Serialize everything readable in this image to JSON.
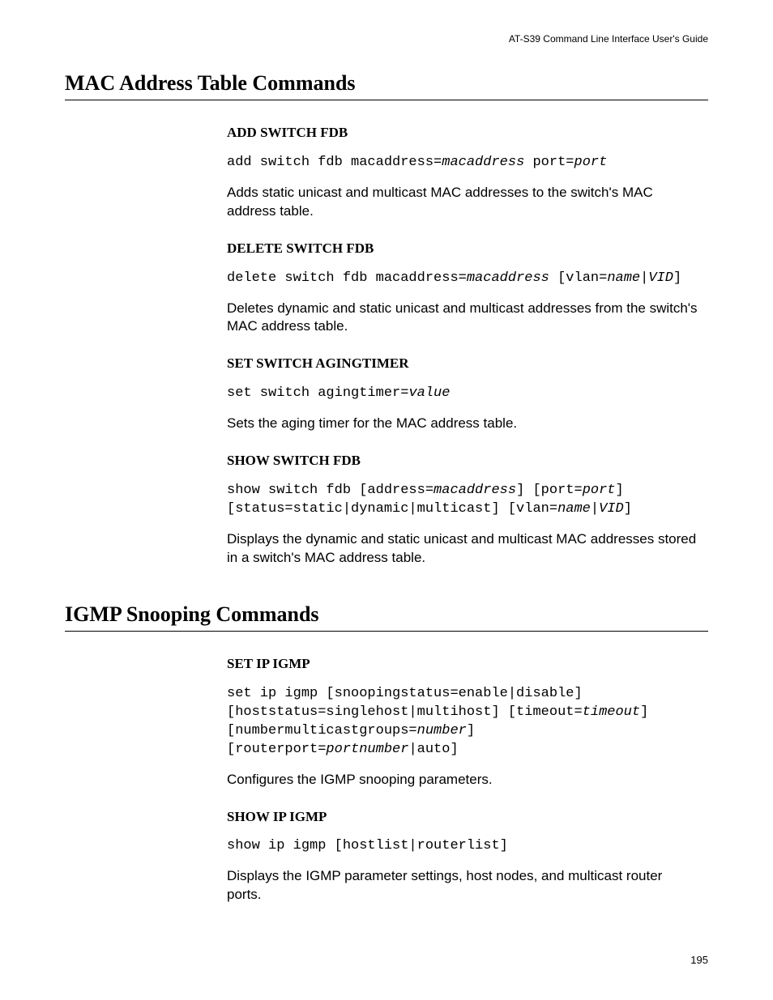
{
  "header": "AT-S39 Command Line Interface User's Guide",
  "pageNumber": "195",
  "sections": [
    {
      "title": "MAC Address Table Commands",
      "commands": [
        {
          "name": "ADD SWITCH FDB",
          "syntax": "add switch fdb macaddress=<i>macaddress</i> port=<i>port</i>",
          "desc": "Adds static unicast and multicast MAC addresses to the switch's MAC address table."
        },
        {
          "name": "DELETE SWITCH FDB",
          "syntax": "delete switch fdb macaddress=<i>macaddress</i> [vlan=<i>name</i>|<i>VID</i>]",
          "desc": "Deletes dynamic and static unicast and multicast addresses from the switch's MAC address table."
        },
        {
          "name": "SET SWITCH AGINGTIMER",
          "syntax": "set switch agingtimer=<i>value</i>",
          "desc": "Sets the aging timer for the MAC address table."
        },
        {
          "name": "SHOW SWITCH FDB",
          "syntax": "show switch fdb [address=<i>macaddress</i>] [port=<i>port</i>] [status=static|dynamic|multicast] [vlan=<i>name</i>|<i>VID</i>]",
          "desc": "Displays the dynamic and static unicast and multicast MAC addresses stored in a switch's MAC address table."
        }
      ]
    },
    {
      "title": "IGMP Snooping Commands",
      "commands": [
        {
          "name": "SET IP IGMP",
          "syntax": "set ip igmp [snoopingstatus=enable|disable] [hoststatus=singlehost|multihost] [timeout=<i>timeout</i>] [numbermulticastgroups=<i>number</i>] [routerport=<i>portnumber</i>|auto]",
          "desc": "Configures the IGMP snooping parameters."
        },
        {
          "name": "SHOW IP IGMP",
          "syntax": "show ip igmp [hostlist|routerlist]",
          "desc": "Displays the IGMP parameter settings, host nodes, and multicast router ports."
        }
      ]
    }
  ]
}
